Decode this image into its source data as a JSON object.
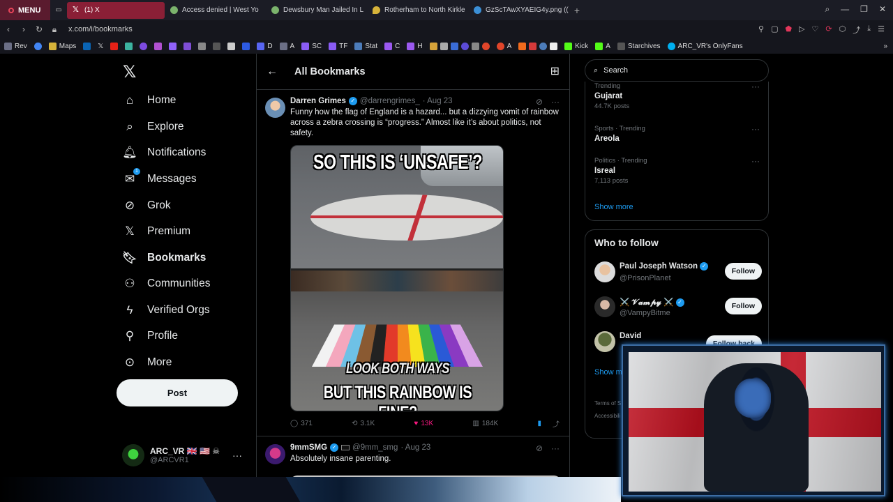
{
  "browser": {
    "menu_label": "MENU",
    "tabs": [
      {
        "title": "(1) X",
        "active": true
      },
      {
        "title": "Access denied | West Yo"
      },
      {
        "title": "Dewsbury Man Jailed In L"
      },
      {
        "title": "Rotherham to North Kirkle"
      },
      {
        "title": "GzScTAwXYAEIG4y.png (("
      }
    ],
    "url": "x.com/i/bookmarks",
    "bookmarks": [
      "Rev",
      "Maps",
      "D",
      "A",
      "SC",
      "TF",
      "Stat",
      "C",
      "H",
      "A",
      "Kick",
      "A",
      "Starchives",
      "ARC_VR's OnlyFans"
    ]
  },
  "sidebar": {
    "items": [
      {
        "label": "Home",
        "icon": "home-icon"
      },
      {
        "label": "Explore",
        "icon": "search-icon"
      },
      {
        "label": "Notifications",
        "icon": "bell-icon"
      },
      {
        "label": "Messages",
        "icon": "envelope-icon",
        "badge": "1"
      },
      {
        "label": "Grok",
        "icon": "grok-icon"
      },
      {
        "label": "Premium",
        "icon": "x-logo-icon"
      },
      {
        "label": "Bookmarks",
        "icon": "bookmark-icon"
      },
      {
        "label": "Communities",
        "icon": "people-icon"
      },
      {
        "label": "Verified Orgs",
        "icon": "lightning-icon"
      },
      {
        "label": "Profile",
        "icon": "person-icon"
      },
      {
        "label": "More",
        "icon": "more-circle-icon"
      }
    ],
    "post_label": "Post",
    "account": {
      "name": "ARC_VR 🇬🇧 🇺🇸 ☠",
      "handle": "@ARCVR1"
    }
  },
  "timeline": {
    "title": "All Bookmarks",
    "tweets": [
      {
        "name": "Darren Grimes",
        "handle": "@darrengrimes_",
        "date": "· Aug 23",
        "text": "Funny how the flag of England is a hazard... but a dizzying vomit of rainbow across a zebra crossing is “progress.” Almost like it’s about politics, not safety.",
        "media_caption_top": "SO THIS IS ‘UNSAFE’?",
        "media_caption_road": "LOOK BOTH WAYS",
        "media_caption_bottom": "BUT THIS RAINBOW IS FINE?",
        "replies": "371",
        "reposts": "3.1K",
        "likes": "13K",
        "views": "184K"
      },
      {
        "name": "9mmSMG",
        "handle": "@9mm_smg",
        "date": "· Aug 23",
        "text": "Absolutely insane parenting."
      }
    ]
  },
  "right": {
    "search_placeholder": "Search",
    "trends": [
      {
        "meta": "Trending",
        "name": "Gujarat",
        "count": "44.7K posts"
      },
      {
        "meta": "Sports · Trending",
        "name": "Areola",
        "count": ""
      },
      {
        "meta": "Politics · Trending",
        "name": "Isreal",
        "count": "7,113 posts"
      }
    ],
    "trends_show_more": "Show more",
    "who_to_follow_title": "Who to follow",
    "who_to_follow": [
      {
        "name": "Paul Joseph Watson",
        "handle": "@PrisonPlanet",
        "button": "Follow"
      },
      {
        "name": "⚔️ 𝓥𝓪𝓶𝓹𝔂 ⚔️",
        "handle": "@VampyBitme",
        "button": "Follow"
      },
      {
        "name": "David",
        "handle": "",
        "button": "Follow back"
      }
    ],
    "wtf_show_more": "Show m",
    "legal_1": "Terms of S",
    "legal_2": "Accessibili"
  }
}
